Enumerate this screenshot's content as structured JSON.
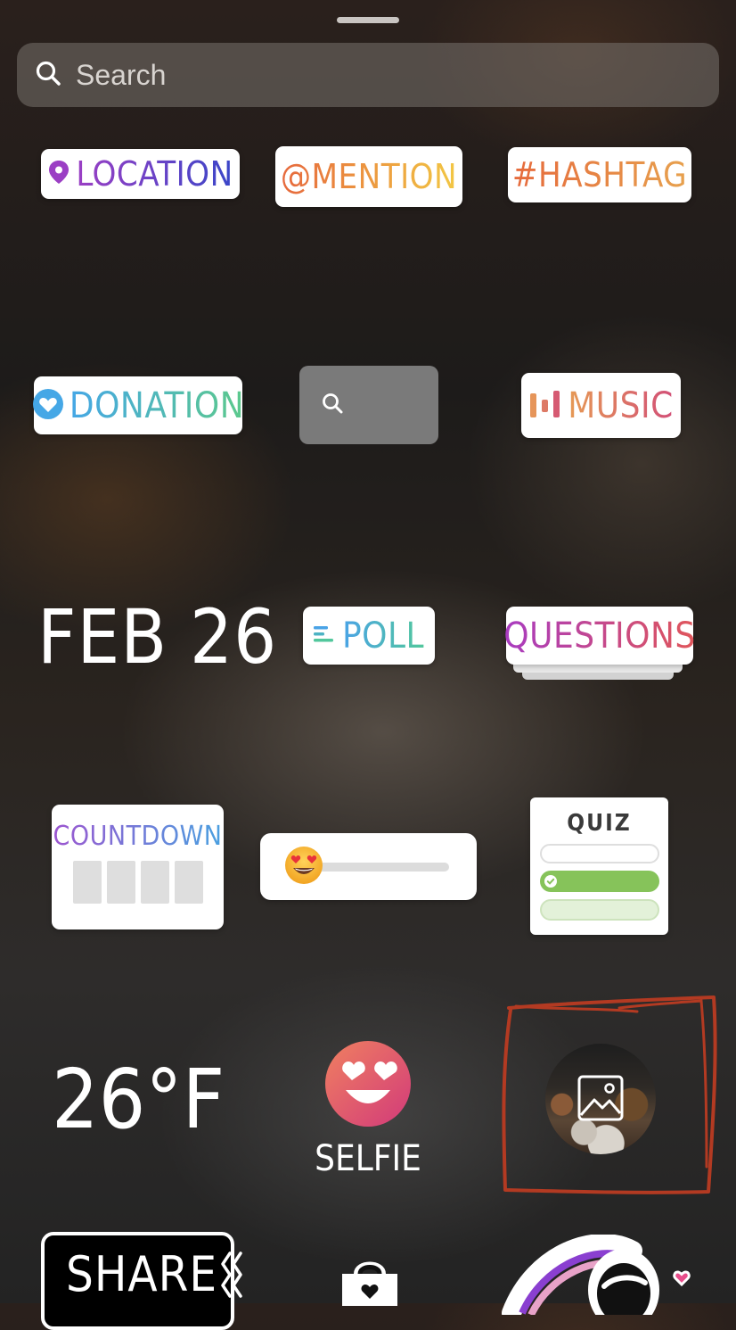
{
  "search": {
    "placeholder": "Search"
  },
  "stickers": {
    "location": "LOCATION",
    "mention": "@MENTION",
    "hashtag": "#HASHTAG",
    "donation": "DONATION",
    "music": "MUSIC",
    "date": "FEB 26",
    "poll": "POLL",
    "questions": "QUESTIONS",
    "countdown": "COUNTDOWN",
    "quiz": "QUIZ",
    "temperature": "26°F",
    "selfie": "SELFIE",
    "share": "SHARE"
  },
  "icons": {
    "search": "search-icon",
    "location_pin": "location-pin-icon",
    "heart": "heart-icon",
    "gif_search": "search-icon",
    "music_bars": "music-bars-icon",
    "poll_lines": "poll-lines-icon",
    "emoji": "heart-eyes-emoji-icon",
    "photo": "image-icon",
    "shopping_bag": "shopping-bag-icon"
  },
  "colors": {
    "location_gradient": [
      "#9b3fc4",
      "#3a46c8"
    ],
    "mention_gradient": [
      "#e6683c",
      "#f2c744"
    ],
    "hashtag_gradient": [
      "#e66a3c",
      "#e7a14e"
    ],
    "donation_gradient": [
      "#45a7e6",
      "#5cc98c"
    ],
    "music_gradient": [
      "#e69a54",
      "#d24f77"
    ],
    "poll_gradient": [
      "#4aa3e6",
      "#52c79c"
    ],
    "questions_gradient": [
      "#a83bc1",
      "#e0565a"
    ],
    "countdown_gradient": [
      "#9c56d0",
      "#4aa0e0"
    ],
    "quiz_correct": "#86c35a",
    "annotation": "#b33a22"
  },
  "slider": {
    "value": 0.0
  },
  "quiz": {
    "options": 3,
    "correct_index": 1
  }
}
